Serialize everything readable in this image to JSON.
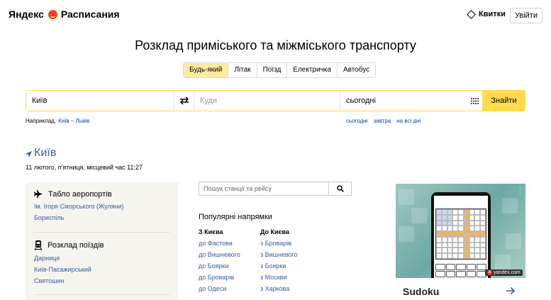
{
  "header": {
    "logo_brand": "Яндекс",
    "logo_product": "Расписания",
    "tickets_label": "Квитки",
    "login_label": "Увійти"
  },
  "title": "Розклад приміського та міжміського транспорту",
  "transport_tabs": [
    {
      "label": "Будь-який",
      "active": true
    },
    {
      "label": "Літак",
      "active": false
    },
    {
      "label": "Поїзд",
      "active": false
    },
    {
      "label": "Електричка",
      "active": false
    },
    {
      "label": "Автобус",
      "active": false
    }
  ],
  "search": {
    "from_value": "Київ",
    "to_placeholder": "Куди",
    "date_value": "сьогодні",
    "find_label": "Знайти"
  },
  "example": {
    "prefix": "Наприклад,",
    "link": "Київ – Львів"
  },
  "date_links": [
    "сьогодні",
    "завтра",
    "на всі дні"
  ],
  "city": {
    "name": "Київ",
    "datetime": "11 лютого, п'ятниця, місцевий час 11:27"
  },
  "airports": {
    "title": "Табло аеропортів",
    "items": [
      "Ім. Ігоря Сікорського (Жуляни)",
      "Бориспіль"
    ]
  },
  "trains": {
    "title": "Розклад поїздів",
    "items": [
      "Дарниця",
      "Київ-Пасажирський",
      "Святошин"
    ]
  },
  "station_search": {
    "placeholder": "Пошук станції та рейсу"
  },
  "popular": {
    "title": "Популярні напрямки",
    "from_head": "З Києва",
    "from_items": [
      "до Фастова",
      "до Вишневого",
      "до Боярки",
      "до Броварів",
      "до Одеси"
    ],
    "to_head": "До Києва",
    "to_items": [
      "з Броварів",
      "з Вишневого",
      "з Боярки",
      "з Москви",
      "з Харкова"
    ]
  },
  "ad": {
    "title": "Sudoku",
    "badge": "yandex.com",
    "badge_letter": "Я"
  },
  "colors": {
    "accent_yellow": "#ffdb4d",
    "active_tab": "#ffeba0",
    "link_blue": "#3a5ba0",
    "panel_bg": "#f5f4ef"
  }
}
